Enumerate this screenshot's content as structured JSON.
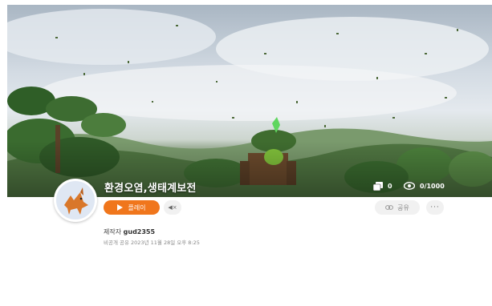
{
  "project": {
    "title": "환경오염,생태계보전",
    "remix_count": "0",
    "view_count": "0/1000"
  },
  "actions": {
    "play_label": "플레이",
    "mute_label": "◀×",
    "share_label": "공유",
    "more_label": "···"
  },
  "creator": {
    "prefix": "제작자",
    "name": "gud2355"
  },
  "meta": {
    "visibility_and_date": "비공개 공유 2023년 11월 28일 오후 8:25"
  },
  "colors": {
    "accent": "#f0761c",
    "button_bg": "#f1f1f1"
  },
  "icons": {
    "play": "play-icon",
    "remix": "remix-icon",
    "eye": "eye-icon",
    "link": "link-icon"
  }
}
